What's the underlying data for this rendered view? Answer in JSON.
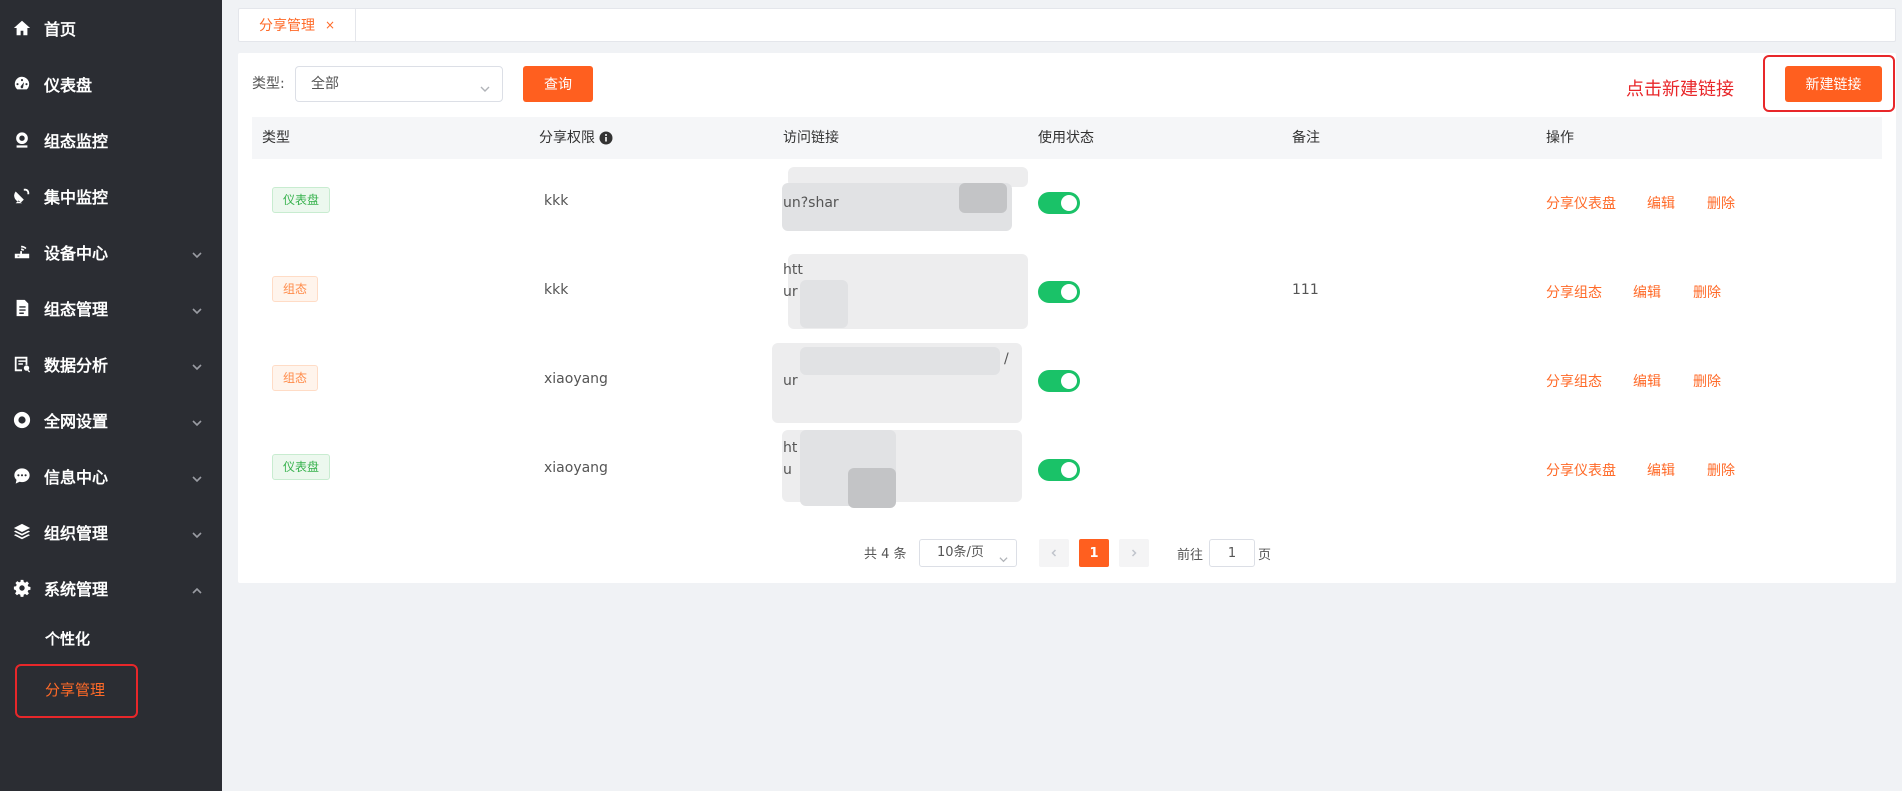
{
  "sidebar": {
    "items": [
      {
        "label": "首页",
        "icon": "home-icon"
      },
      {
        "label": "仪表盘",
        "icon": "dashboard-icon"
      },
      {
        "label": "组态监控",
        "icon": "webcam-icon"
      },
      {
        "label": "集中监控",
        "icon": "satellite-dish-icon"
      },
      {
        "label": "设备中心",
        "icon": "router-icon"
      },
      {
        "label": "组态管理",
        "icon": "document-icon"
      },
      {
        "label": "数据分析",
        "icon": "report-icon"
      },
      {
        "label": "全网设置",
        "icon": "circle-settings-icon"
      },
      {
        "label": "信息中心",
        "icon": "chat-bubble-icon"
      },
      {
        "label": "组织管理",
        "icon": "layers-icon"
      },
      {
        "label": "系统管理",
        "icon": "gear-icon"
      }
    ],
    "sub_items": [
      {
        "label": "个性化"
      },
      {
        "label": "分享管理",
        "active": true
      }
    ]
  },
  "tabs": [
    {
      "label": "分享管理",
      "close": "×"
    }
  ],
  "filter": {
    "type_label": "类型:",
    "type_value": "全部",
    "query_button": "查询"
  },
  "hint_text": "点击新建链接",
  "new_link_button": "新建链接",
  "table": {
    "columns": [
      "类型",
      "分享权限",
      "访问链接",
      "使用状态",
      "备注",
      "操作"
    ],
    "rows": [
      {
        "type": "仪表盘",
        "type_color": "green",
        "permission": "kkk",
        "link_lines": [
          "",
          "un?shar"
        ],
        "enabled": true,
        "remark": "",
        "actions": [
          "分享仪表盘",
          "编辑",
          "删除"
        ]
      },
      {
        "type": "组态",
        "type_color": "orange",
        "permission": "kkk",
        "link_lines": [
          "htt",
          "ur"
        ],
        "enabled": true,
        "remark": "111",
        "actions": [
          "分享组态",
          "编辑",
          "删除"
        ]
      },
      {
        "type": "组态",
        "type_color": "orange",
        "permission": "xiaoyang",
        "link_lines": [
          "/",
          "ur"
        ],
        "enabled": true,
        "remark": "",
        "actions": [
          "分享组态",
          "编辑",
          "删除"
        ]
      },
      {
        "type": "仪表盘",
        "type_color": "green",
        "permission": "xiaoyang",
        "link_lines": [
          "ht",
          "u"
        ],
        "enabled": true,
        "remark": "",
        "actions": [
          "分享仪表盘",
          "编辑",
          "删除"
        ]
      }
    ]
  },
  "pagination": {
    "total": "共 4 条",
    "page_size": "10条/页",
    "current_page": "1",
    "goto_prefix": "前往",
    "goto_value": "1",
    "goto_suffix": "页"
  },
  "colors": {
    "accent": "#ff5f1f",
    "sidebar_bg": "#2b2d33",
    "annotation": "#e8272a",
    "switch_on": "#1ac268"
  }
}
